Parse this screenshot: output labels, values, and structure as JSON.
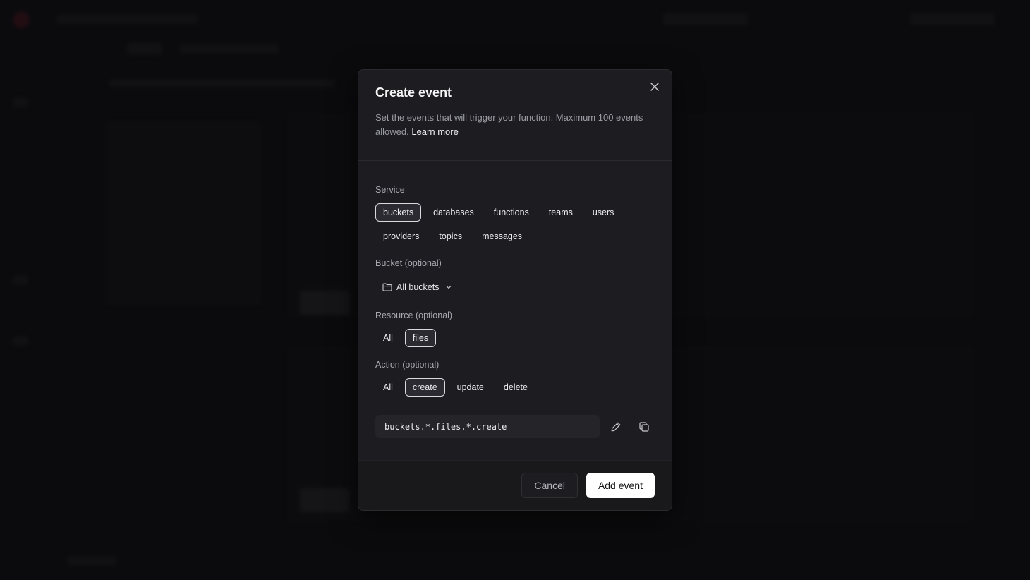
{
  "modal": {
    "title": "Create event",
    "description": "Set the events that will trigger your function. Maximum 100 events allowed.",
    "learn_more": "Learn more",
    "service": {
      "label": "Service",
      "options": [
        "buckets",
        "databases",
        "functions",
        "teams",
        "users",
        "providers",
        "topics",
        "messages"
      ],
      "selected": "buckets"
    },
    "bucket": {
      "label": "Bucket (optional)",
      "value": "All buckets"
    },
    "resource": {
      "label": "Resource (optional)",
      "options": [
        "All",
        "files"
      ],
      "selected": "files"
    },
    "action": {
      "label": "Action (optional)",
      "options": [
        "All",
        "create",
        "update",
        "delete"
      ],
      "selected": "create"
    },
    "event_string": "buckets.*.files.*.create",
    "footer": {
      "cancel": "Cancel",
      "add": "Add event"
    }
  },
  "icons": {
    "close": "close-icon",
    "folder": "folder-icon",
    "chevron": "chevron-down-icon",
    "edit": "pencil-icon",
    "copy": "copy-icon"
  },
  "colors": {
    "modal_bg": "#1d1d21",
    "primary_button_bg": "#ffffff",
    "selected_pill_border": "#d9d9de"
  }
}
